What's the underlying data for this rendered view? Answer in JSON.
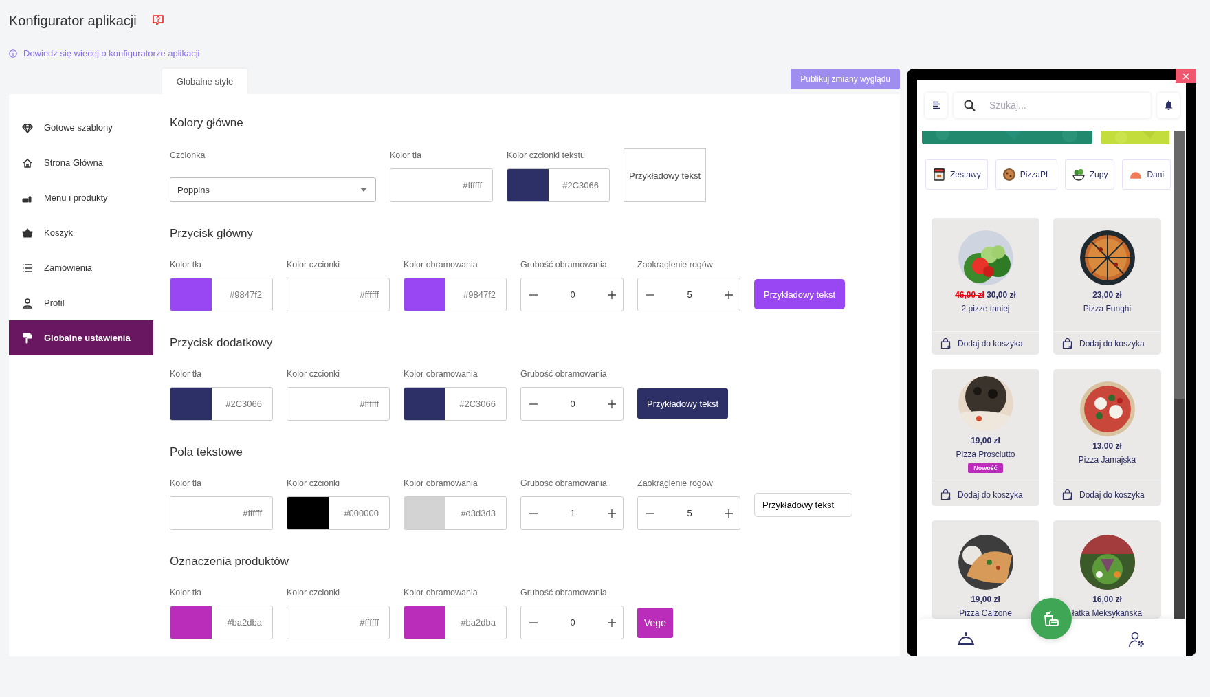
{
  "header": {
    "title": "Konfigurator aplikacji",
    "help_link": "Dowiedz się więcej o konfiguratorze aplikacji"
  },
  "tabs": [
    {
      "label": "Globalne style",
      "selected": true
    }
  ],
  "publish_button": "Publikuj zmiany wyglądu",
  "sidebar": {
    "items": [
      {
        "label": "Gotowe szablony",
        "selected": false
      },
      {
        "label": "Strona Główna",
        "selected": false
      },
      {
        "label": "Menu i produkty",
        "selected": false
      },
      {
        "label": "Koszyk",
        "selected": false
      },
      {
        "label": "Zamówienia",
        "selected": false
      },
      {
        "label": "Profil",
        "selected": false
      },
      {
        "label": "Globalne ustawienia",
        "selected": true
      }
    ]
  },
  "sections": [
    {
      "title": "Kolory główne",
      "fields": [
        {
          "kind": "select",
          "label": "Czcionka",
          "value": "Poppins"
        },
        {
          "kind": "color",
          "label": "Kolor tła",
          "value": "#ffffff"
        },
        {
          "kind": "color",
          "label": "Kolor czcionki tekstu",
          "value": "#2C3066"
        }
      ],
      "preview": {
        "kind": "box",
        "text": "Przykładowy tekst"
      }
    },
    {
      "title": "Przycisk główny",
      "fields": [
        {
          "kind": "color",
          "label": "Kolor tła",
          "value": "#9847f2"
        },
        {
          "kind": "color",
          "label": "Kolor czcionki",
          "value": "#ffffff"
        },
        {
          "kind": "color",
          "label": "Kolor obramowania",
          "value": "#9847f2"
        },
        {
          "kind": "stepper",
          "label": "Grubość obramowania",
          "value": "0"
        },
        {
          "kind": "stepper",
          "label": "Zaokrąglenie rogów",
          "value": "5"
        }
      ],
      "preview": {
        "kind": "button",
        "text": "Przykładowy tekst"
      }
    },
    {
      "title": "Przycisk dodatkowy",
      "fields": [
        {
          "kind": "color",
          "label": "Kolor tła",
          "value": "#2C3066"
        },
        {
          "kind": "color",
          "label": "Kolor czcionki",
          "value": "#ffffff"
        },
        {
          "kind": "color",
          "label": "Kolor obramowania",
          "value": "#2C3066"
        },
        {
          "kind": "stepper",
          "label": "Grubość obramowania",
          "value": "0"
        }
      ],
      "preview": {
        "kind": "button",
        "text": "Przykładowy tekst"
      }
    },
    {
      "title": "Pola tekstowe",
      "fields": [
        {
          "kind": "color",
          "label": "Kolor tła",
          "value": "#ffffff"
        },
        {
          "kind": "color",
          "label": "Kolor czcionki",
          "value": "#000000"
        },
        {
          "kind": "color",
          "label": "Kolor obramowania",
          "value": "#d3d3d3"
        },
        {
          "kind": "stepper",
          "label": "Grubość obramowania",
          "value": "1"
        },
        {
          "kind": "stepper",
          "label": "Zaokrąglenie rogów",
          "value": "5"
        }
      ],
      "preview": {
        "kind": "input",
        "text": "Przykładowy tekst"
      }
    },
    {
      "title": "Oznaczenia produktów",
      "fields": [
        {
          "kind": "color",
          "label": "Kolor tła",
          "value": "#ba2dba"
        },
        {
          "kind": "color",
          "label": "Kolor czcionki",
          "value": "#ffffff"
        },
        {
          "kind": "color",
          "label": "Kolor obramowania",
          "value": "#ba2dba"
        },
        {
          "kind": "stepper",
          "label": "Grubość obramowania",
          "value": "0"
        }
      ],
      "preview": {
        "kind": "badge",
        "text": "Vege"
      }
    }
  ],
  "phone": {
    "search": {
      "placeholder": "Szukaj..."
    },
    "categories": [
      {
        "label": "Zestawy"
      },
      {
        "label": "PizzaPL"
      },
      {
        "label": "Zupy"
      },
      {
        "label": "Dani"
      }
    ],
    "products": [
      {
        "old_price": "46,00 zł",
        "price": "30,00 zł",
        "name": "2 pizze taniej",
        "add_label": "Dodaj do koszyka"
      },
      {
        "price": "23,00 zł",
        "name": "Pizza Funghi",
        "add_label": "Dodaj do koszyka"
      },
      {
        "price": "19,00 zł",
        "name": "Pizza Prosciutto",
        "badge": "Nowość",
        "add_label": "Dodaj do koszyka"
      },
      {
        "price": "13,00 zł",
        "name": "Pizza Jamajska",
        "add_label": "Dodaj do koszyka"
      },
      {
        "price": "19,00 zł",
        "name": "Pizza Calzone"
      },
      {
        "price": "16,00 zł",
        "name": "łatka Meksykańska"
      }
    ]
  }
}
